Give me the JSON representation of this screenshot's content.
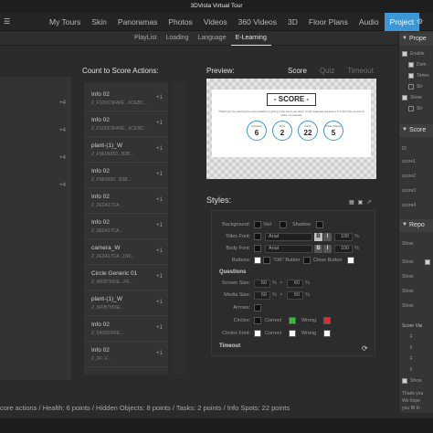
{
  "app": {
    "title": "3DVista Virtual Tour"
  },
  "main_tabs": [
    "My Tours",
    "Skin",
    "Panoramas",
    "Photos",
    "Videos",
    "360 Videos",
    "3D",
    "Floor Plans",
    "Audio",
    "Project"
  ],
  "sub_tabs": [
    "PlayList",
    "Loading",
    "Language",
    "E-Learning"
  ],
  "left_panel": {
    "rows": [
      "+4",
      "+4",
      "+4",
      "+4"
    ]
  },
  "count_to_score": {
    "title": "Count to Score Actions:",
    "items": [
      {
        "name": "Info 02",
        "code": "2_F1D0C9FA0E...6CEBC...",
        "points": "+1"
      },
      {
        "name": "Info 02",
        "code": "2_F1D0C9FA0E...6CEBC...",
        "points": "+1"
      },
      {
        "name": "plant-(1)_W",
        "code": "2_F9E09350...B3B...",
        "points": "+1"
      },
      {
        "name": "Info 02",
        "code": "2_F9E0930...B3B...",
        "points": "+1"
      },
      {
        "name": "Info 02",
        "code": "2_2E2A17CA...",
        "points": "+1"
      },
      {
        "name": "Info 02",
        "code": "2_2E2A17CA...",
        "points": "+1"
      },
      {
        "name": "camera_W",
        "code": "2_2E2A17CA...DW...",
        "points": "+1"
      },
      {
        "name": "Circle Generic 01",
        "code": "2_WFB7550E...FF...",
        "points": "+1"
      },
      {
        "name": "plant-(1)_W",
        "code": "2_WFB7550E...",
        "points": "+1"
      },
      {
        "name": "Info 02",
        "code": "2_5A0DFRFE...",
        "points": "+1"
      },
      {
        "name": "Info 02",
        "code": "2_2F...F...",
        "points": "+1"
      }
    ]
  },
  "preview": {
    "label": "Preview:",
    "tabs": [
      "Score",
      "Quiz",
      "Timeout"
    ],
    "card": {
      "title": "- SCORE -",
      "text": "Thank you for passing the responsibility by giving 1 the hand you want. It with selected question's 1 to fill in the scores to make me hearted.",
      "circles": [
        {
          "label": "Questions",
          "value": "6"
        },
        {
          "label": "Score",
          "value": "2"
        },
        {
          "label": "Points",
          "value": "22"
        },
        {
          "label": "Hidden Objects",
          "value": "5"
        }
      ]
    }
  },
  "styles": {
    "title": "Styles:",
    "icons": [
      "grid-icon",
      "save-icon",
      "share-icon"
    ],
    "labels": {
      "background": "Background:",
      "veil": "Veil",
      "shadow": "Shadow",
      "titles_font": "Titles Font:",
      "body_font": "Body Font:",
      "buttons": "Buttons:",
      "ok_button": "\"OK\" Button",
      "close_button": "Close Button",
      "questions": "Questions",
      "screen_size": "Screen Size:",
      "media_size": "Media Size:",
      "arrows": "Arrows:",
      "circles": "Circles:",
      "correct": "Correct",
      "wrong": "Wrong",
      "circles_font": "Circles Font:",
      "timeout": "Timeout"
    },
    "values": {
      "font_name": "Arial",
      "titles_pct": "100",
      "body_pct": "100",
      "screen_w": "60",
      "screen_h": "60",
      "media_w": "60",
      "media_h": "60",
      "bold": "B",
      "italic": "I",
      "unit_pct": "%",
      "times": "×"
    },
    "colors": {
      "correct": "#2fbf3a",
      "wrong": "#e22b2b",
      "white": "#ffffff",
      "black": "#111111"
    }
  },
  "right_panel": {
    "sections": [
      {
        "title": "Prope"
      },
      {
        "title": "Score"
      },
      {
        "title": "Repo"
      }
    ],
    "props_rows": [
      "Enable",
      "Dom",
      "Timeo",
      "Sh",
      "Show",
      "Sh"
    ],
    "score_rows": [
      "ID",
      "score1",
      "score2",
      "score3",
      "score4"
    ],
    "repo_rows": [
      "Show",
      "Show",
      "Show",
      "Show",
      "Show"
    ],
    "score_visibility": "Score Visi",
    "bottom_rows": [
      "F",
      "F",
      "F",
      "F",
      "Show",
      "Thank you",
      "We hope",
      "you fill th"
    ]
  },
  "status_bar": {
    "text": "core actions / Health: 6 points / Hidden Objects: 8 points / Tasks: 2 points / Info Spots: 22 points"
  }
}
